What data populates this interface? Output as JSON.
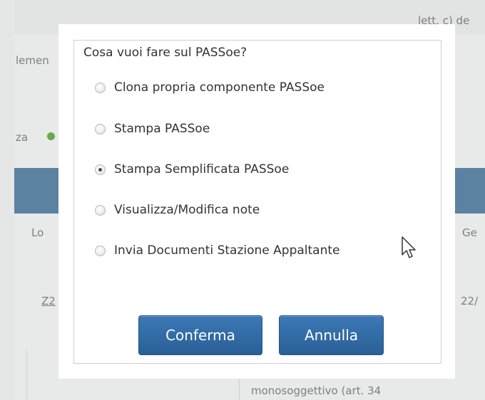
{
  "background": {
    "top_right_text": "lett. c) de",
    "left_row1_text": "lemen",
    "left_row2_text": "za",
    "col_left_header": "Lo",
    "col_right_header": "Ge",
    "row_left_value": "Z2",
    "row_right_value": "22/",
    "bottom_text": "monosoggettivo (art. 34",
    "header_color": "#5c82a1"
  },
  "dialog": {
    "question": "Cosa vuoi fare sul PASSoe?",
    "options": [
      {
        "label": "Clona propria componente PASSoe",
        "selected": false
      },
      {
        "label": "Stampa PASSoe",
        "selected": false
      },
      {
        "label": "Stampa Semplificata PASSoe",
        "selected": true
      },
      {
        "label": "Visualizza/Modifica note",
        "selected": false
      },
      {
        "label": "Invia Documenti Stazione Appaltante",
        "selected": false
      }
    ],
    "confirm_label": "Conferma",
    "cancel_label": "Annulla",
    "button_color": "#2f6aa6"
  },
  "icons": {
    "status_check": "check-icon",
    "pointer": "mouse-cursor-icon"
  }
}
